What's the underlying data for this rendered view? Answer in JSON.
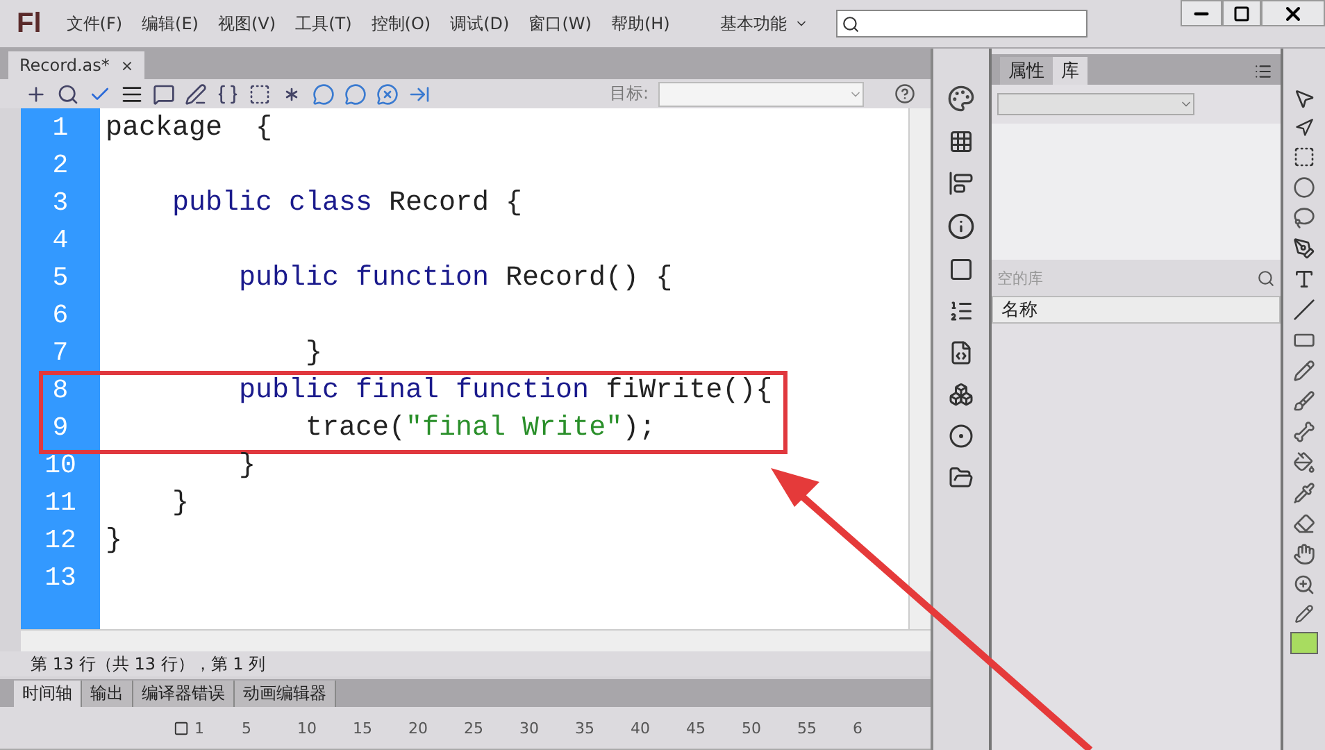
{
  "app": {
    "logo": "Fl",
    "menu": [
      "文件(F)",
      "编辑(E)",
      "视图(V)",
      "工具(T)",
      "控制(O)",
      "调试(D)",
      "窗口(W)",
      "帮助(H)"
    ],
    "workspace": "基本功能"
  },
  "document_tabs": [
    {
      "label": "Record.as*",
      "close": "×",
      "selected": true
    }
  ],
  "toolbar": {
    "target_label": "目标:"
  },
  "code": {
    "lines": [
      {
        "number": "1",
        "highlighted": false,
        "tokens": [
          {
            "text": "package  {",
            "kind": "plain"
          }
        ]
      },
      {
        "number": "2",
        "highlighted": false
      },
      {
        "number": "3",
        "highlighted": false,
        "tokens": [
          {
            "text": "    public class ",
            "kind": "keyword"
          },
          {
            "text": "Record {",
            "kind": "plain"
          }
        ]
      },
      {
        "number": "4",
        "highlighted": false
      },
      {
        "number": "5",
        "highlighted": false,
        "tokens": [
          {
            "text": "        public function ",
            "kind": "keyword"
          },
          {
            "text": "Record() {",
            "kind": "plain"
          }
        ]
      },
      {
        "number": "6",
        "highlighted": false
      },
      {
        "number": "7",
        "highlighted": false,
        "tokens": [
          {
            "text": "            }",
            "kind": "plain"
          }
        ]
      },
      {
        "number": "8",
        "highlighted": true,
        "tokens": [
          {
            "text": "        public final function ",
            "kind": "keyword"
          },
          {
            "text": "fiWrite(){",
            "kind": "plain"
          }
        ]
      },
      {
        "number": "9",
        "highlighted": true,
        "tokens": [
          {
            "text": "            trace(",
            "kind": "plain"
          },
          {
            "text": "\"final Write\"",
            "kind": "string"
          },
          {
            "text": ");",
            "kind": "plain"
          }
        ]
      },
      {
        "number": "10",
        "highlighted": false,
        "tokens": [
          {
            "text": "        }",
            "kind": "plain"
          }
        ]
      },
      {
        "number": "11",
        "highlighted": false,
        "tokens": [
          {
            "text": "    }",
            "kind": "plain"
          }
        ]
      },
      {
        "number": "12",
        "highlighted": false,
        "tokens": [
          {
            "text": "}",
            "kind": "plain"
          }
        ]
      },
      {
        "number": "13",
        "highlighted": false
      }
    ]
  },
  "status_bar": "第 13 行（共 13 行），第 1 列",
  "bottom_tabs": [
    {
      "label": "时间轴",
      "selected": true
    },
    {
      "label": "输出",
      "selected": false
    },
    {
      "label": "编译器错误",
      "selected": false
    },
    {
      "label": "动画编辑器",
      "selected": false
    }
  ],
  "timeline": {
    "frames": [
      "1",
      "5",
      "10",
      "15",
      "20",
      "25",
      "30",
      "35",
      "40",
      "45",
      "50",
      "55",
      "6"
    ]
  },
  "library_panel": {
    "tabs": [
      {
        "label": "属性",
        "selected": false
      },
      {
        "label": "库",
        "selected": true
      }
    ],
    "status": "空的库",
    "column": "名称"
  }
}
